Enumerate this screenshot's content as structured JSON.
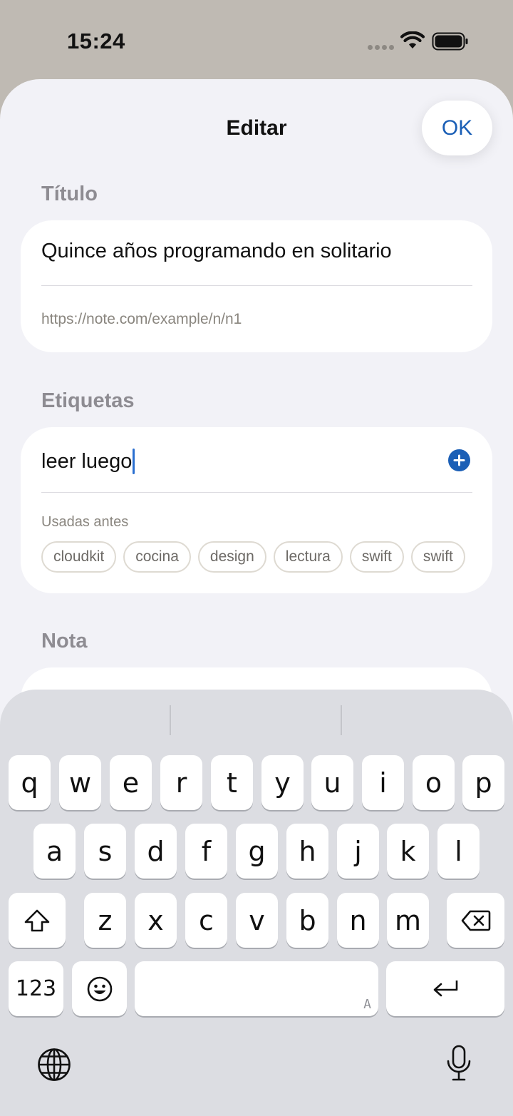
{
  "status_bar": {
    "time": "15:24"
  },
  "sheet": {
    "title": "Editar",
    "ok_label": "OK",
    "sections": {
      "title_label": "Título",
      "tags_label": "Etiquetas",
      "note_label": "Nota"
    },
    "title_field": {
      "value": "Quince años programando en solitario",
      "url": "https://note.com/example/n/n1"
    },
    "tags_field": {
      "value": "leer luego",
      "used_before_label": "Usadas antes",
      "chips": [
        "cloudkit",
        "cocina",
        "design",
        "lectura",
        "swift",
        "swift"
      ]
    }
  },
  "keyboard": {
    "row1": [
      "q",
      "w",
      "e",
      "r",
      "t",
      "y",
      "u",
      "i",
      "o",
      "p"
    ],
    "row2": [
      "a",
      "s",
      "d",
      "f",
      "g",
      "h",
      "j",
      "k",
      "l"
    ],
    "row3": [
      "z",
      "x",
      "c",
      "v",
      "b",
      "n",
      "m"
    ],
    "numbers_label": "123",
    "space_hint": "A",
    "icons": {
      "shift": "shift-icon",
      "delete": "delete-icon",
      "emoji": "emoji-icon",
      "return": "return-icon",
      "globe": "globe-icon",
      "mic": "microphone-icon"
    }
  }
}
